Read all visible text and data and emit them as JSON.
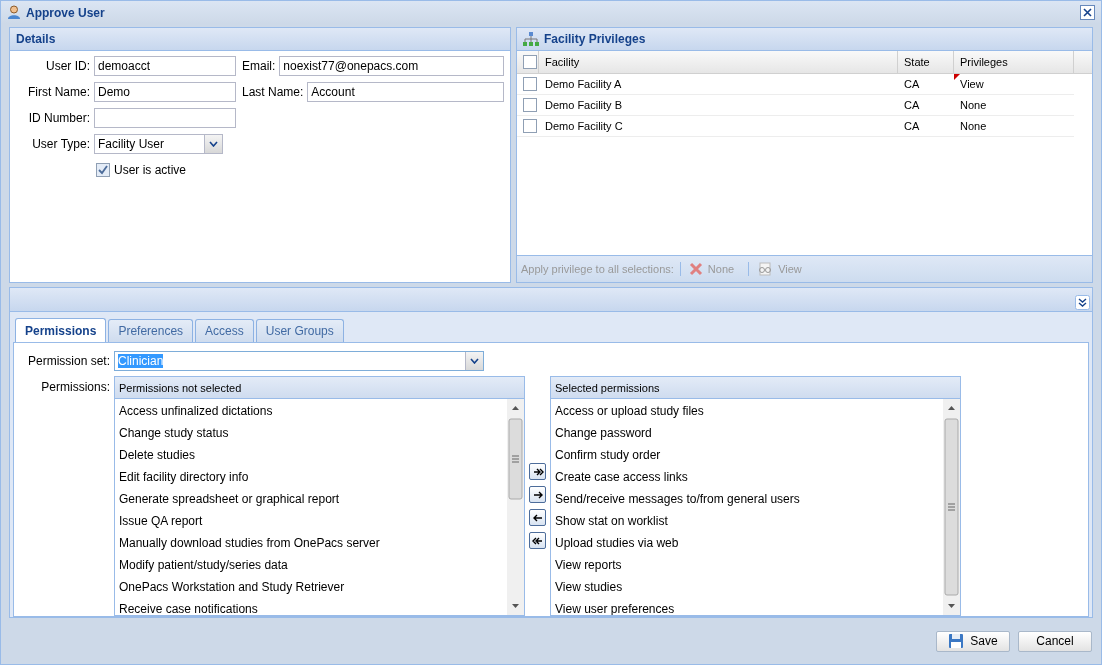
{
  "window": {
    "title": "Approve User"
  },
  "details": {
    "title": "Details",
    "rows": [
      [
        {
          "label": "User ID:",
          "value": "demoacct"
        },
        {
          "label": "Email:",
          "value": "noexist77@onepacs.com"
        }
      ],
      [
        {
          "label": "First Name:",
          "value": "Demo"
        },
        {
          "label": "Last Name:",
          "value": "Account"
        }
      ],
      [
        {
          "label": "ID Number:"
        }
      ]
    ],
    "user_type": {
      "label": "User Type:",
      "value": "Facility User"
    },
    "active": {
      "label": "User is active",
      "checked": true
    }
  },
  "facility": {
    "title": "Facility Privileges",
    "header_checked": false,
    "columns": [
      "Facility",
      "State",
      "Privileges"
    ],
    "rows": [
      {
        "facility": "Demo Facility A",
        "state": "CA",
        "privileges": "View",
        "checked": false,
        "modified": true
      },
      {
        "facility": "Demo Facility B",
        "state": "CA",
        "privileges": "None",
        "checked": false,
        "modified": false
      },
      {
        "facility": "Demo Facility C",
        "state": "CA",
        "privileges": "None",
        "checked": false,
        "modified": false
      }
    ],
    "toolbar": {
      "label": "Apply privilege to all selections:",
      "buttons": [
        {
          "kind": "none",
          "label": "None",
          "disabled": true
        },
        {
          "kind": "view",
          "label": "View",
          "disabled": true
        }
      ]
    }
  },
  "tabs": [
    {
      "label": "Permissions",
      "selected": true
    },
    {
      "label": "Preferences",
      "selected": false
    },
    {
      "label": "Access",
      "selected": false
    },
    {
      "label": "User Groups",
      "selected": false
    }
  ],
  "permission_set": {
    "label": "Permission set:",
    "value": "Clinician"
  },
  "permissions": {
    "label": "Permissions:",
    "available": {
      "title": "Permissions not selected",
      "items": [
        "Access unfinalized dictations",
        "Change study status",
        "Delete studies",
        "Edit facility directory info",
        "Generate spreadsheet or graphical report",
        "Issue QA report",
        "Manually download studies from OnePacs server",
        "Modify patient/study/series data",
        "OnePacs Workstation and Study Retriever",
        "Receive case notifications"
      ]
    },
    "selected": {
      "title": "Selected permissions",
      "items": [
        "Access or upload study files",
        "Change password",
        "Confirm study order",
        "Create case access links",
        "Send/receive messages to/from general users",
        "Show stat on worklist",
        "Upload studies via web",
        "View reports",
        "View studies",
        "View user preferences"
      ]
    }
  },
  "buttons": [
    {
      "kind": "save",
      "label": "Save"
    },
    {
      "kind": "cancel",
      "label": "Cancel"
    }
  ]
}
